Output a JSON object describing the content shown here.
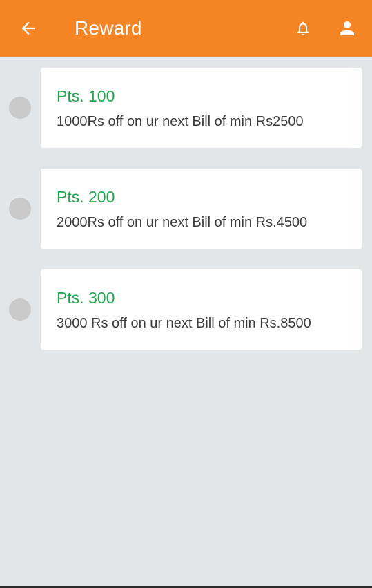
{
  "appbar": {
    "title": "Reward",
    "back_icon": "arrow-left-icon",
    "notification_icon": "bell-icon",
    "profile_icon": "person-icon",
    "color": "#f58524"
  },
  "rewards": [
    {
      "points_label": "Pts. 100",
      "description": "1000Rs off on ur next Bill of min Rs2500"
    },
    {
      "points_label": "Pts. 200",
      "description": "2000Rs off on ur next Bill of min Rs.4500"
    },
    {
      "points_label": "Pts. 300",
      "description": "3000 Rs off on ur next Bill of min Rs.8500"
    }
  ],
  "colors": {
    "points_text": "#1fa64b",
    "background": "#e2e6e8",
    "radio": "#c9c9c9"
  }
}
